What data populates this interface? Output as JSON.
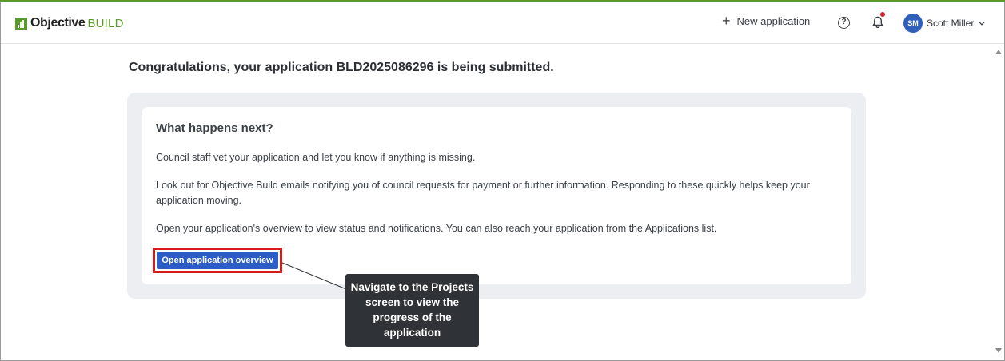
{
  "header": {
    "logo_word": "Objective",
    "logo_word2": "BUILD",
    "new_application_label": "New application",
    "help_glyph": "?",
    "user": {
      "initials": "SM",
      "name": "Scott Miller"
    }
  },
  "main": {
    "headline": "Congratulations, your application BLD2025086296 is being submitted.",
    "card": {
      "title": "What happens next?",
      "paragraph_1": "Council staff vet your application and let you know if anything is missing.",
      "paragraph_2": "Look out for Objective Build emails notifying you of council requests for payment or further information. Responding to these quickly helps keep your application moving.",
      "paragraph_3": "Open your application's overview to view status and notifications. You can also reach your application from the Applications list.",
      "button_label": "Open application overview"
    }
  },
  "callout": {
    "text": "Navigate to the Projects screen to view the progress of the application"
  },
  "icons": {
    "logo": "objective-build-logo-icon",
    "plus": "plus-icon",
    "help": "help-icon",
    "bell": "bell-icon",
    "chevron": "chevron-down-icon"
  },
  "colors": {
    "accent_green": "#5a9a2a",
    "primary_button": "#2c5cc5",
    "highlight_red": "#d81a1a",
    "avatar_blue": "#2f5fb8",
    "notification_dot": "#d21f2b",
    "callout_bg": "#2f3338"
  }
}
